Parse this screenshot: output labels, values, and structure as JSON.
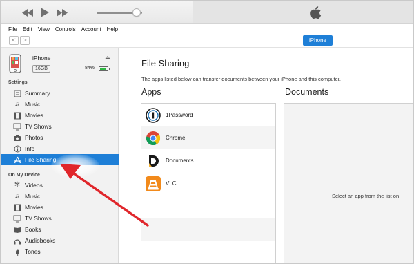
{
  "menu": [
    "File",
    "Edit",
    "View",
    "Controls",
    "Account",
    "Help"
  ],
  "nav": {
    "back_label": "<",
    "forward_label": ">",
    "device_button": "iPhone"
  },
  "player": {
    "volume_level": 0.88
  },
  "device": {
    "name": "iPhone",
    "capacity": "16GB",
    "battery_pct": "84%",
    "battery_level": 0.84,
    "eject_glyph": "⏏",
    "charge_glyph": "+"
  },
  "sidebar": {
    "settings_header": "Settings",
    "settings": [
      {
        "label": "Summary",
        "icon": "summary-icon"
      },
      {
        "label": "Music",
        "icon": "music-note-icon"
      },
      {
        "label": "Movies",
        "icon": "film-icon"
      },
      {
        "label": "TV Shows",
        "icon": "tv-icon"
      },
      {
        "label": "Photos",
        "icon": "camera-icon"
      },
      {
        "label": "Info",
        "icon": "info-icon"
      },
      {
        "label": "File Sharing",
        "icon": "app-store-icon",
        "selected": true
      }
    ],
    "ondevice_header": "On My Device",
    "ondevice": [
      {
        "label": "Videos",
        "icon": "gear-icon"
      },
      {
        "label": "Music",
        "icon": "music-note-icon"
      },
      {
        "label": "Movies",
        "icon": "film-icon"
      },
      {
        "label": "TV Shows",
        "icon": "tv-icon"
      },
      {
        "label": "Books",
        "icon": "book-icon"
      },
      {
        "label": "Audiobooks",
        "icon": "audiobook-icon"
      },
      {
        "label": "Tones",
        "icon": "bell-icon"
      }
    ]
  },
  "main": {
    "title": "File Sharing",
    "description": "The apps listed below can transfer documents between your iPhone and this computer.",
    "apps_header": "Apps",
    "documents_header": "Documents",
    "apps": [
      {
        "name": "1Password",
        "icon": "onepassword-icon"
      },
      {
        "name": "Chrome",
        "icon": "chrome-icon"
      },
      {
        "name": "Documents",
        "icon": "documents-icon"
      },
      {
        "name": "VLC",
        "icon": "vlc-icon"
      }
    ],
    "documents_message": "Select an app from the list on"
  },
  "colors": {
    "accent": "#1e7fd7",
    "annotation_arrow": "#e0262b",
    "battery": "#2fb843"
  }
}
